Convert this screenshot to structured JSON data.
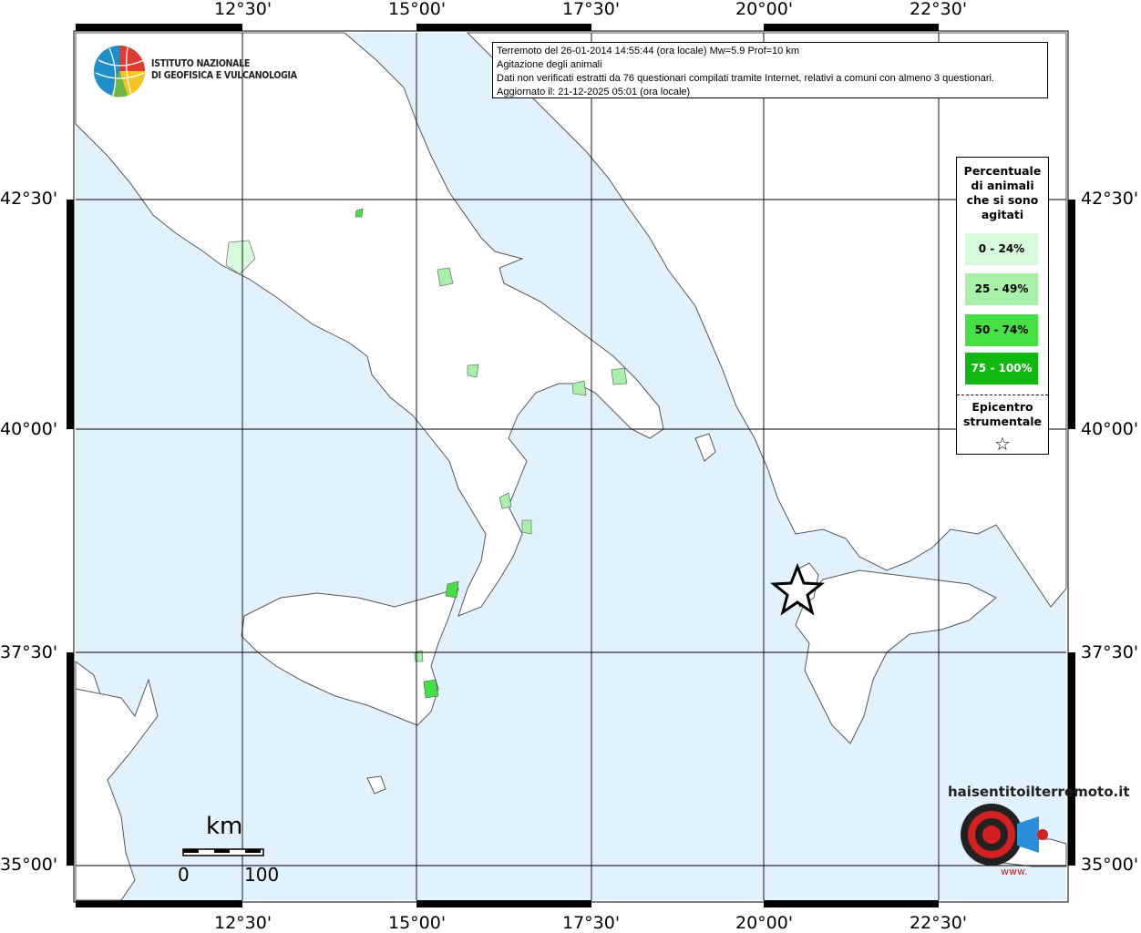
{
  "info": {
    "line1": "Terremoto del 26-01-2014 14:55:44 (ora locale) Mw=5.9 Prof=10 km",
    "line2": "Agitazione degli animali",
    "line3": "Dati non verificati estratti da 76 questionari compilati tramite Internet, relativi a comuni con almeno 3 questionari.",
    "line4": "Aggiornato il: 21-12-2025 05:01 (ora locale)"
  },
  "legend": {
    "title": "Percentuale di animali che si sono agitati",
    "bins": [
      {
        "label": "0 - 24%",
        "color": "#d8fadc"
      },
      {
        "label": "25 - 49%",
        "color": "#a6f0a8"
      },
      {
        "label": "50 - 74%",
        "color": "#44e044"
      },
      {
        "label": "75 - 100%",
        "color": "#12b812"
      }
    ],
    "epicenter_label": "Epicentro strumentale",
    "epicenter_symbol": "☆"
  },
  "axes": {
    "lon_labels": [
      "12°30'",
      "15°00'",
      "17°30'",
      "20°00'",
      "22°30'"
    ],
    "lat_labels": [
      "42°30'",
      "40°00'",
      "37°30'",
      "35°00'"
    ]
  },
  "scale_bar": {
    "unit": "km",
    "min": "0",
    "max": "100"
  },
  "logos": {
    "ingv_line1": "ISTITUTO NAZIONALE",
    "ingv_line2": "DI GEOFISICA E VULCANOLOGIA",
    "hsit_text": "haisentitoilterremoto.it",
    "hsit_url": "www."
  },
  "colors": {
    "sea": "#e1f2fd",
    "land": "#ffffff",
    "grid": "#000000"
  }
}
